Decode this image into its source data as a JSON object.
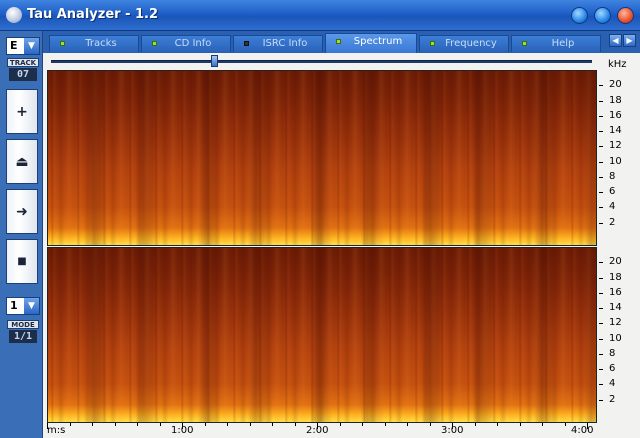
{
  "window": {
    "title": "Tau Analyzer - 1.2"
  },
  "left": {
    "drive": "E",
    "track_label": "TRACK",
    "track_number": "07",
    "buttons": [
      {
        "name": "add-button",
        "glyph": "+"
      },
      {
        "name": "eject-button",
        "glyph": "⏏"
      },
      {
        "name": "play-button",
        "glyph": "➜"
      },
      {
        "name": "stop-button",
        "glyph": "■"
      }
    ],
    "mode_select": "1",
    "mode_label": "MODE",
    "mode_value": "1/1"
  },
  "tabs": [
    {
      "label": "Tracks",
      "active": false,
      "led": "green"
    },
    {
      "label": "CD Info",
      "active": false,
      "led": "green"
    },
    {
      "label": "ISRC Info",
      "active": false,
      "led": "dark"
    },
    {
      "label": "Spectrum",
      "active": true,
      "led": "green"
    },
    {
      "label": "Frequency",
      "active": false,
      "led": "green"
    },
    {
      "label": "Help",
      "active": false,
      "led": "green"
    }
  ],
  "spectrum": {
    "y_unit": "kHz",
    "y_ticks": [
      "20",
      "18",
      "16",
      "14",
      "12",
      "10",
      "8",
      "6",
      "4",
      "2"
    ],
    "x_unit": "m:s",
    "x_ticks": [
      "1:00",
      "2:00",
      "3:00",
      "4:00"
    ]
  },
  "colors": {
    "title_bar": "#1f5fc8",
    "panel": "#3a6fb8",
    "spectrum_hot": "#ffe04a",
    "spectrum_mid": "#c5500f",
    "spectrum_cold": "#8d2a0b"
  }
}
